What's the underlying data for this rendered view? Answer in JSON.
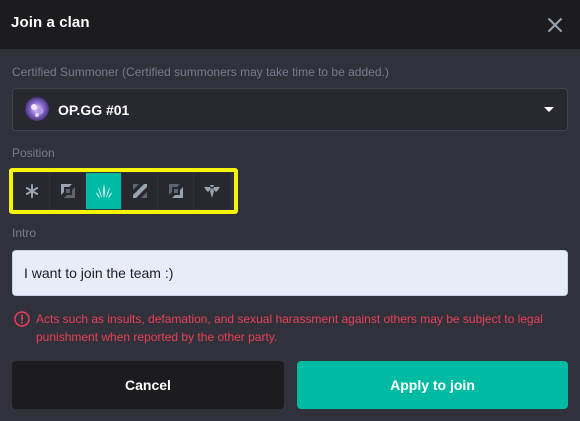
{
  "dialog": {
    "title": "Join a clan",
    "close_icon": "close-icon"
  },
  "summoner": {
    "label": "Certified Summoner (Certified summoners may take time to be added.)",
    "selected": "OP.GG #01",
    "avatar_icon": "summoner-avatar",
    "dropdown_icon": "caret-down-icon"
  },
  "position": {
    "label": "Position",
    "options": [
      {
        "name": "all",
        "icon": "all-positions-icon",
        "selected": false
      },
      {
        "name": "top",
        "icon": "top-lane-icon",
        "selected": false
      },
      {
        "name": "jungle",
        "icon": "jungle-icon",
        "selected": true
      },
      {
        "name": "mid",
        "icon": "mid-lane-icon",
        "selected": false
      },
      {
        "name": "bottom",
        "icon": "bottom-lane-icon",
        "selected": false
      },
      {
        "name": "support",
        "icon": "support-icon",
        "selected": false
      }
    ],
    "highlight_color": "#f5f50a",
    "active_color": "#00bba3"
  },
  "intro": {
    "label": "Intro",
    "value": "I want to join the team :)"
  },
  "warning": {
    "text": "Acts such as insults, defamation, and sexual harassment against others may be subject to legal punishment when reported by the other party.",
    "color": "#e84057"
  },
  "buttons": {
    "cancel": "Cancel",
    "join": "Apply to join"
  }
}
